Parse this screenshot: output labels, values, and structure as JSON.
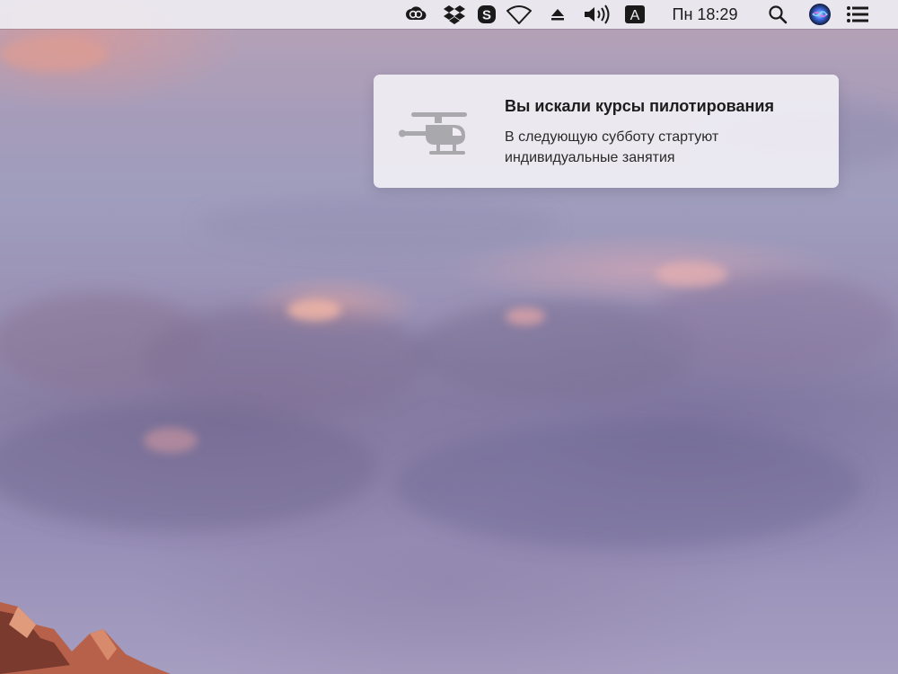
{
  "menubar": {
    "icons": [
      {
        "name": "creative-cloud-icon"
      },
      {
        "name": "dropbox-icon"
      },
      {
        "name": "skype-icon"
      },
      {
        "name": "wifi-icon"
      },
      {
        "name": "eject-icon"
      },
      {
        "name": "volume-icon"
      },
      {
        "name": "input-source-icon",
        "glyph": "A"
      },
      {
        "name": "spotlight-search-icon"
      },
      {
        "name": "siri-icon"
      },
      {
        "name": "notification-center-icon"
      }
    ],
    "clock": "Пн 18:29",
    "input_source_letter": "A"
  },
  "notification": {
    "icon": "helicopter-icon",
    "title": "Вы искали курсы пилотирования",
    "body": "В следующую субботу стартуют индивидуальные занятия"
  },
  "colors": {
    "menubar_bg": "#eeecf2",
    "notification_bg": "#f0eef4",
    "icon_gray": "#a9a9ad",
    "siri_blue": "#3f6ee8"
  }
}
